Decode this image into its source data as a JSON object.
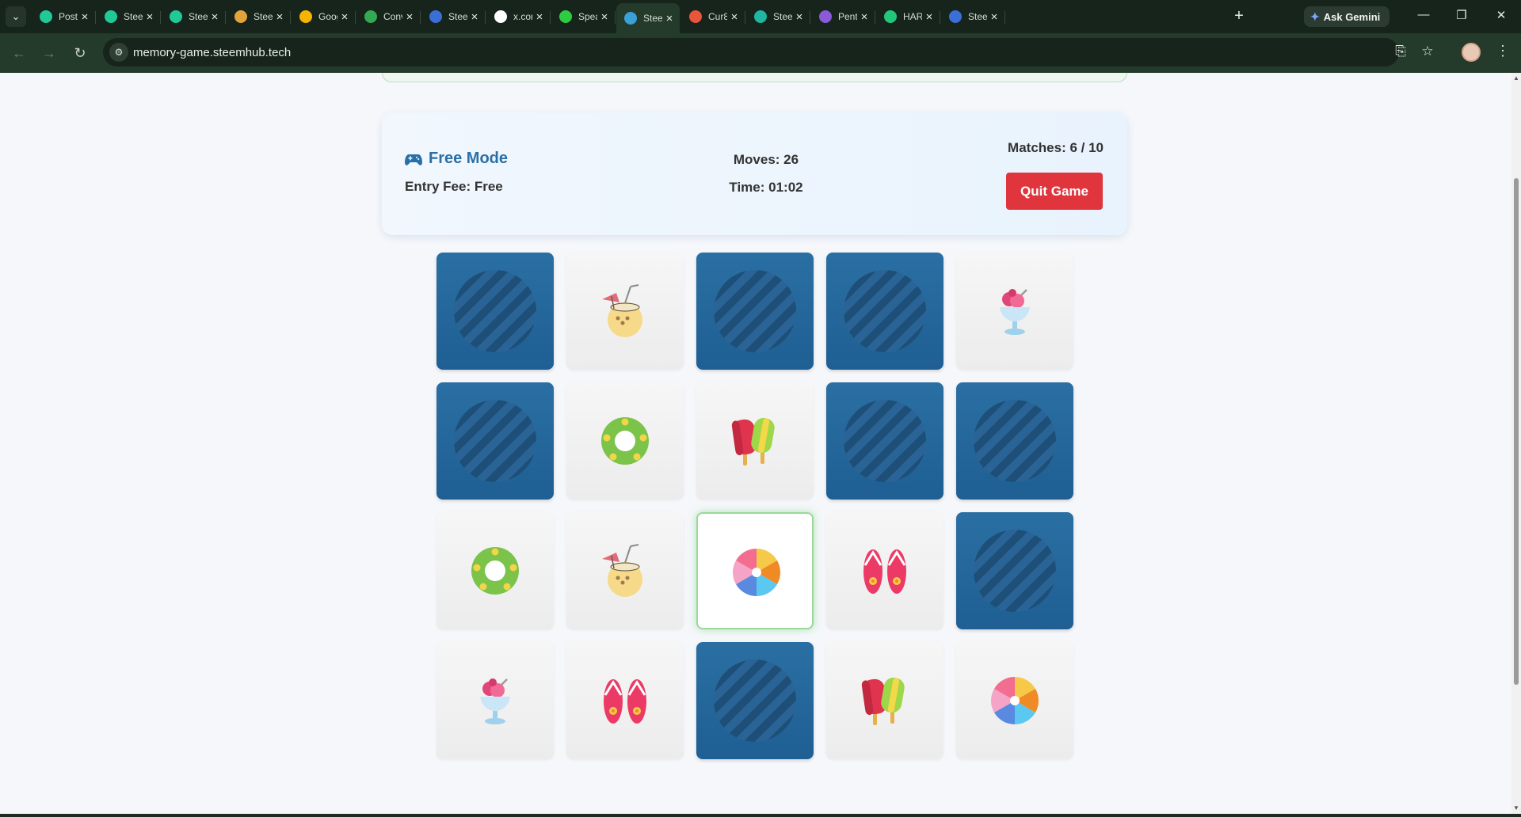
{
  "browser": {
    "tabs": [
      {
        "title": "Post",
        "favicon": "steem-logo-icon",
        "color": "#20c997"
      },
      {
        "title": "Steem",
        "favicon": "steem-logo-icon",
        "color": "#20c997"
      },
      {
        "title": "Steem",
        "favicon": "steem-logo-icon",
        "color": "#20c997"
      },
      {
        "title": "Steem",
        "favicon": "emoji-face-icon",
        "color": "#e0a43c"
      },
      {
        "title": "Google",
        "favicon": "lightbulb-icon",
        "color": "#f4b400"
      },
      {
        "title": "Conv",
        "favicon": "drive-icon",
        "color": "#34a853"
      },
      {
        "title": "Steem",
        "favicon": "globe-icon",
        "color": "#3b6fd8"
      },
      {
        "title": "x.com",
        "favicon": "x-logo-icon",
        "color": "#ffffff"
      },
      {
        "title": "Speak",
        "favicon": "play-icon",
        "color": "#2ecc40"
      },
      {
        "title": "Steem",
        "favicon": "globe-icon",
        "color": "#3aa0d8"
      },
      {
        "title": "Cur8",
        "favicon": "cur8-icon",
        "color": "#e8553a"
      },
      {
        "title": "Steem",
        "favicon": "steem-circle-icon",
        "color": "#1fb5a0"
      },
      {
        "title": "Pent",
        "favicon": "pent-icon",
        "color": "#8a5ad8"
      },
      {
        "title": "HARD",
        "favicon": "hard-icon",
        "color": "#23c77a"
      },
      {
        "title": "Steem",
        "favicon": "globe-icon",
        "color": "#3b6fd8"
      }
    ],
    "active_tab": 9,
    "ask_gemini": "Ask Gemini",
    "url": "memory-game.steemhub.tech"
  },
  "game": {
    "mode": "Free Mode",
    "mode_icon": "gamepad-icon",
    "entry_fee": "Entry Fee: Free",
    "moves": "Moves: 26",
    "time": "Time: 01:02",
    "matches": "Matches: 6 / 10",
    "quit_label": "Quit Game"
  },
  "board": {
    "rows": 4,
    "columns": 5,
    "cards": [
      {
        "state": "hidden"
      },
      {
        "state": "revealed",
        "symbol": "coconut-drink"
      },
      {
        "state": "hidden"
      },
      {
        "state": "hidden"
      },
      {
        "state": "revealed",
        "symbol": "ice-cream-sundae"
      },
      {
        "state": "hidden"
      },
      {
        "state": "revealed",
        "symbol": "swim-ring"
      },
      {
        "state": "revealed",
        "symbol": "popsicles"
      },
      {
        "state": "hidden"
      },
      {
        "state": "hidden"
      },
      {
        "state": "revealed",
        "symbol": "swim-ring"
      },
      {
        "state": "revealed",
        "symbol": "coconut-drink"
      },
      {
        "state": "selected",
        "symbol": "beach-ball"
      },
      {
        "state": "revealed",
        "symbol": "flip-flops"
      },
      {
        "state": "hidden"
      },
      {
        "state": "revealed",
        "symbol": "ice-cream-sundae"
      },
      {
        "state": "revealed",
        "symbol": "flip-flops"
      },
      {
        "state": "hidden"
      },
      {
        "state": "revealed",
        "symbol": "popsicles"
      },
      {
        "state": "revealed",
        "symbol": "beach-ball"
      }
    ]
  },
  "colors": {
    "card_back": "#1f5f93",
    "quit_button": "#e0353d",
    "mode_title": "#2a6fa6",
    "selected_glow": "#9ad99a"
  }
}
